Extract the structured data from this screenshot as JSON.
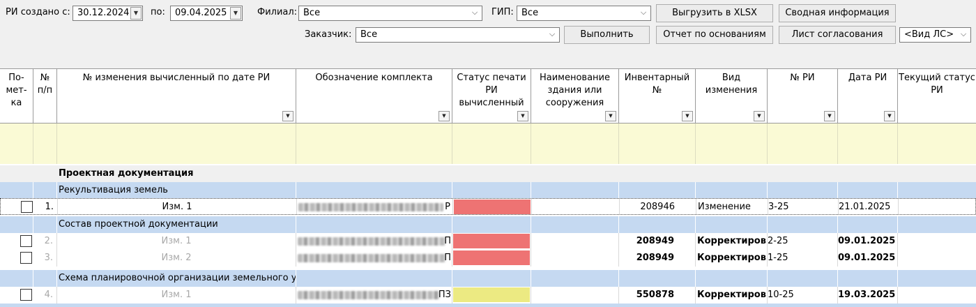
{
  "toolbar": {
    "date_from_label": "РИ создано с:",
    "date_from": "30.12.2024",
    "date_to_label": "по:",
    "date_to": "09.04.2025",
    "branch_label": "Филиал:",
    "branch_value": "Все",
    "gip_label": "ГИП:",
    "gip_value": "Все",
    "customer_label": "Заказчик:",
    "customer_value": "Все",
    "export_button": "Выгрузить в XLSX",
    "summary_button": "Сводная информация",
    "execute_button": "Выполнить",
    "grounds_report_button": "Отчет по основаниям",
    "approval_sheet_button": "Лист согласования",
    "ls_type_value": "<Вид ЛС>"
  },
  "columns": [
    "По-\nмет-\nка",
    "№\nп/п",
    "№ изменения вычисленный по дате РИ",
    "Обозначение комплекта",
    "Статус печати РИ вычисленный",
    "Наименование здания или сооружения",
    "Инвентарный №",
    "Вид изменения",
    "№ РИ",
    "Дата РИ",
    "Текущий статус РИ"
  ],
  "section_title": "Проектная документация",
  "groups": [
    {
      "title": "Рекультивация земель",
      "rows": [
        {
          "num": "1.",
          "change_no": "Изм. 1",
          "code_tail": "Р",
          "status_color": "#ee7373",
          "inventory": "208946",
          "change_type": "Изменение",
          "ri_no": "3-25",
          "ri_date": "21.01.2025",
          "muted": false,
          "bold_type": false
        }
      ]
    },
    {
      "title": "Состав проектной документации",
      "rows": [
        {
          "num": "2.",
          "change_no": "Изм. 1",
          "code_tail": "П",
          "status_color": "#ee7373",
          "inventory": "208949",
          "change_type": "Корректиров",
          "ri_no": "2-25",
          "ri_date": "09.01.2025",
          "muted": true,
          "bold_type": true
        },
        {
          "num": "3.",
          "change_no": "Изм. 2",
          "code_tail": "П",
          "status_color": "#ee7373",
          "inventory": "208949",
          "change_type": "Корректиров",
          "ri_no": "1-25",
          "ri_date": "09.01.2025",
          "muted": true,
          "bold_type": true
        }
      ]
    },
    {
      "title": "Схема планировочной организации земельного уча",
      "rows": [
        {
          "num": "4.",
          "change_no": "Изм. 1",
          "code_tail": "ПЗ",
          "status_color": "#ecea82",
          "inventory": "550878",
          "change_type": "Корректиров",
          "ri_no": "10-25",
          "ri_date": "19.03.2025",
          "muted": true,
          "bold_type": true
        }
      ]
    }
  ],
  "icons": {
    "dropdown": "chevron-down-icon",
    "filter": "filter-arrow-icon",
    "checkbox": "checkbox-icon"
  }
}
